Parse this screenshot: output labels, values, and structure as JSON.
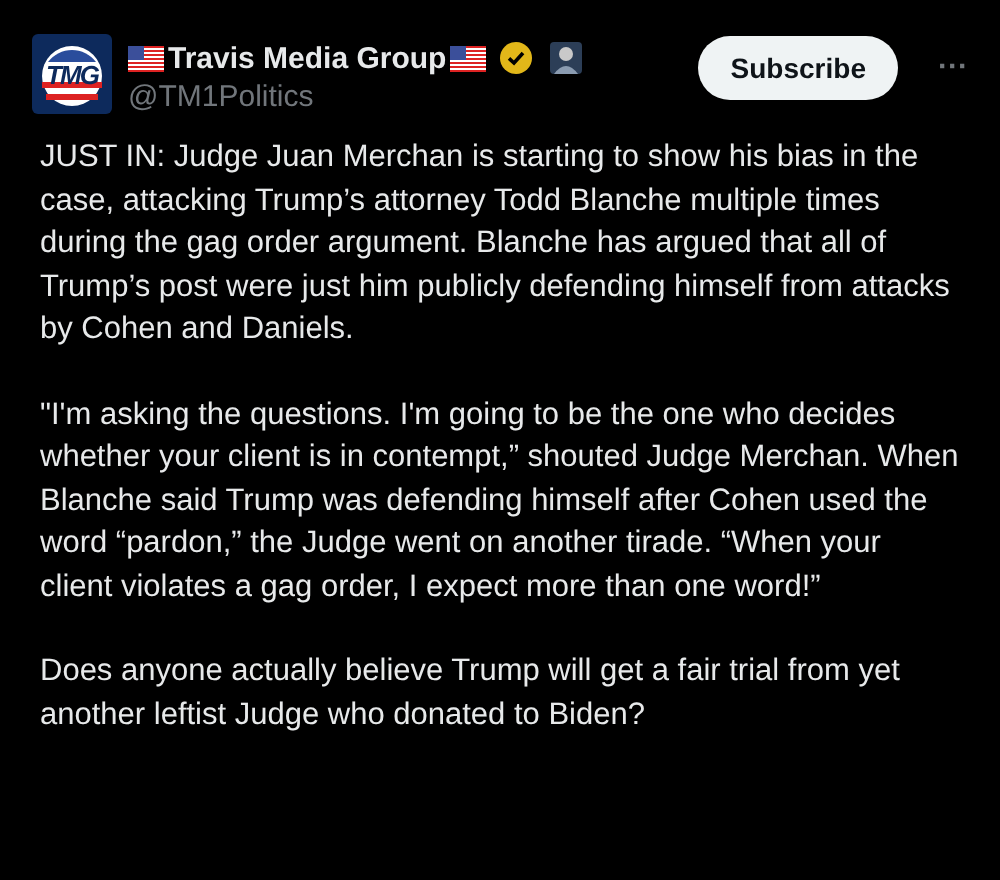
{
  "author": {
    "logo_text": "TMG",
    "name": "Travis Media Group",
    "verified": true,
    "handle": "@TM1Politics"
  },
  "subscribe_button": "Subscribe",
  "more_button": "···",
  "paragraphs": [
    "JUST IN:  Judge Juan Merchan is starting to show his bias in the case, attacking Trump’s attorney Todd Blanche multiple times during the gag order argument.  Blanche has argued that all of Trump’s post were just him publicly defending himself from attacks by Cohen and Daniels.",
    "\"I'm asking the questions. I'm going to be the one who decides whether your client is in contempt,” shouted Judge Merchan.  When Blanche said Trump was defending himself after Cohen used the word “pardon,” the Judge went on another tirade. “When your client violates a gag order, I expect more than one word!”",
    "Does anyone actually believe Trump will get a fair trial from yet another leftist Judge who donated to Biden?"
  ]
}
